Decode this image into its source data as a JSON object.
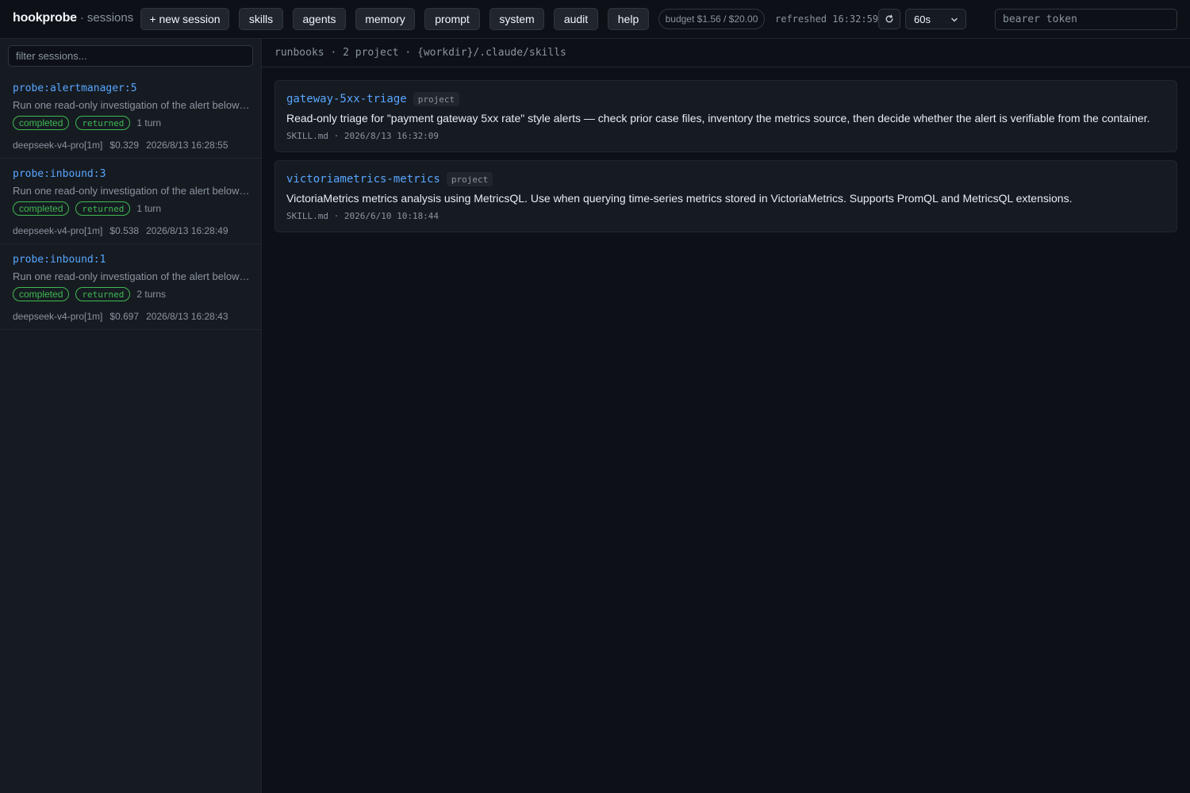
{
  "header": {
    "brand": "hookprobe",
    "separator": "·",
    "section": "sessions",
    "nav": {
      "new_session": "+ new session",
      "skills": "skills",
      "agents": "agents",
      "memory": "memory",
      "prompt": "prompt",
      "system": "system",
      "audit": "audit",
      "help": "help"
    },
    "budget": "budget $1.56 / $20.00",
    "refreshed": "refreshed 16:32:59",
    "refresh_icon": "refresh-icon",
    "interval": "60s",
    "token_placeholder": "bearer token"
  },
  "sidebar": {
    "filter_placeholder": "filter sessions...",
    "sessions": [
      {
        "title": "probe:alertmanager:5",
        "desc": "Run one read-only investigation of the alert below: ...",
        "status": "completed",
        "result": "returned",
        "turns": "1 turn",
        "model": "deepseek-v4-pro[1m]",
        "cost": "$0.329",
        "time": "2026/8/13 16:28:55"
      },
      {
        "title": "probe:inbound:3",
        "desc": "Run one read-only investigation of the alert below: ...",
        "status": "completed",
        "result": "returned",
        "turns": "1 turn",
        "model": "deepseek-v4-pro[1m]",
        "cost": "$0.538",
        "time": "2026/8/13 16:28:49"
      },
      {
        "title": "probe:inbound:1",
        "desc": "Run one read-only investigation of the alert below: ...",
        "status": "completed",
        "result": "returned",
        "turns": "2 turns",
        "model": "deepseek-v4-pro[1m]",
        "cost": "$0.697",
        "time": "2026/8/13 16:28:43"
      }
    ]
  },
  "main": {
    "heading": "runbooks · 2 project · {workdir}/.claude/skills",
    "skills": [
      {
        "name": "gateway-5xx-triage",
        "scope": "project",
        "desc": "Read-only triage for \"payment gateway 5xx rate\" style alerts — check prior case files, inventory the metrics source, then decide whether the alert is verifiable from the container.",
        "meta": "SKILL.md · 2026/8/13 16:32:09"
      },
      {
        "name": "victoriametrics-metrics",
        "scope": "project",
        "desc": "VictoriaMetrics metrics analysis using MetricsQL. Use when querying time-series metrics stored in VictoriaMetrics. Supports PromQL and MetricsQL extensions.",
        "meta": "SKILL.md · 2026/6/10 10:18:44"
      }
    ]
  },
  "colors": {
    "background": "#0d1117",
    "panel": "#161b22",
    "accent": "#58a6ff",
    "success": "#3fb950",
    "muted": "#8b949e"
  }
}
